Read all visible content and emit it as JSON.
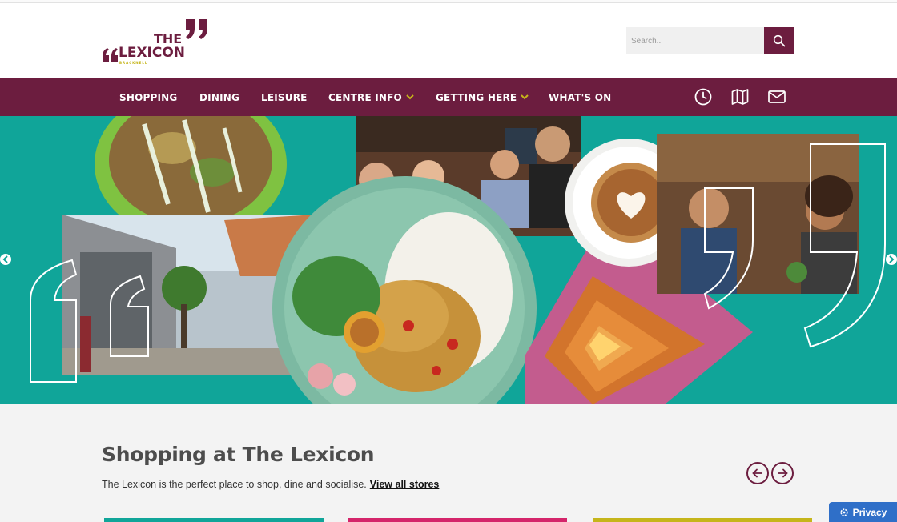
{
  "brand": {
    "logo_the": "THE",
    "logo_name": "LEXICON",
    "logo_sub": "BRACKNELL",
    "primary_color": "#6c1d3f",
    "accent_color": "#c5b51a",
    "hero_color": "#10a599"
  },
  "search": {
    "placeholder": "Search..",
    "icon": "search-icon"
  },
  "nav": {
    "items": [
      {
        "label": "SHOPPING",
        "has_dropdown": false
      },
      {
        "label": "DINING",
        "has_dropdown": false
      },
      {
        "label": "LEISURE",
        "has_dropdown": false
      },
      {
        "label": "CENTRE INFO",
        "has_dropdown": true
      },
      {
        "label": "GETTING HERE",
        "has_dropdown": true
      },
      {
        "label": "WHAT'S ON",
        "has_dropdown": false
      }
    ],
    "icons": [
      "clock-icon",
      "map-icon",
      "mail-icon"
    ]
  },
  "hero": {
    "prev_icon": "chevron-left-icon",
    "next_icon": "chevron-right-icon"
  },
  "section": {
    "title": "Shopping at The Lexicon",
    "intro": "The Lexicon is the perfect place to shop, dine and socialise.",
    "link": "View all stores",
    "card_colors": [
      "#10a599",
      "#d4256a",
      "#c5b51a"
    ]
  },
  "privacy": {
    "label": "Privacy",
    "icon": "gear-icon"
  }
}
